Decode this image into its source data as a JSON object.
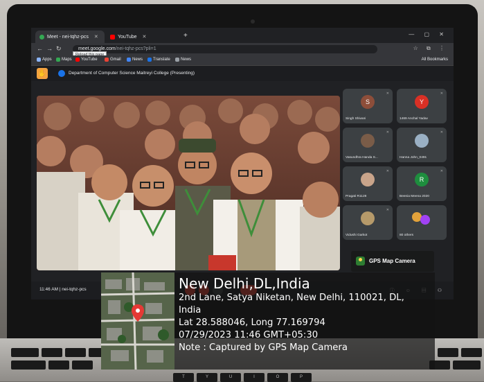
{
  "browser": {
    "tabs": [
      {
        "label": "Meet - nei-tqhz-pcs",
        "active": true
      },
      {
        "label": "YouTube",
        "active": false
      }
    ],
    "address": "meet.google.com/nei-tqhz-pcs?pli=1",
    "address_domain": "meet.google.com",
    "address_path": "/nei-tqhz-pcs?pli=1",
    "tooltip": "Reload this page",
    "bookmarks": [
      "Apps",
      "Maps",
      "YouTube",
      "Gmail",
      "News",
      "Translate",
      "News"
    ],
    "all_bookmarks": "All Bookmarks"
  },
  "meet": {
    "presenting_title": "Department of Computer Science Maitreyi College (Presenting)",
    "meeting_time": "11:46 AM | nei-tqhz-pcs",
    "participants": [
      {
        "name": "Singh Shivani",
        "initial": "S",
        "color": "#8d4e3a"
      },
      {
        "name": "1469 Anchal Yadav",
        "initial": "Y",
        "color": "#d93025"
      },
      {
        "name": "Vasundhra Handa S...",
        "initial": "",
        "color": "#7a5c48"
      },
      {
        "name": "Hanna John_0491",
        "initial": "",
        "color": "#9ab0c4"
      },
      {
        "name": "Pragati R1128",
        "initial": "",
        "color": "#c9a48a"
      },
      {
        "name": "Beenia Meena 2020",
        "initial": "R",
        "color": "#1e8e3e"
      },
      {
        "name": "Vidushi Garkot",
        "initial": "",
        "color": "#b69a6a"
      },
      {
        "name": "80 others",
        "initial": "",
        "color": "#e2a23b"
      }
    ]
  },
  "gps": {
    "app_name": "GPS Map Camera",
    "place": "New Delhi,DL,India",
    "address_line1": "2nd Lane, Satya Niketan, New Delhi, 110021, DL,",
    "address_line2": "India",
    "coords": "Lat 28.588046, Long 77.169794",
    "datetime": "07/29/2023 11:46 GMT+05:30",
    "note": "Note : Captured by GPS Map Camera"
  },
  "keyboard": {
    "keys": [
      "T",
      "Y",
      "U",
      "I",
      "O",
      "P"
    ]
  }
}
